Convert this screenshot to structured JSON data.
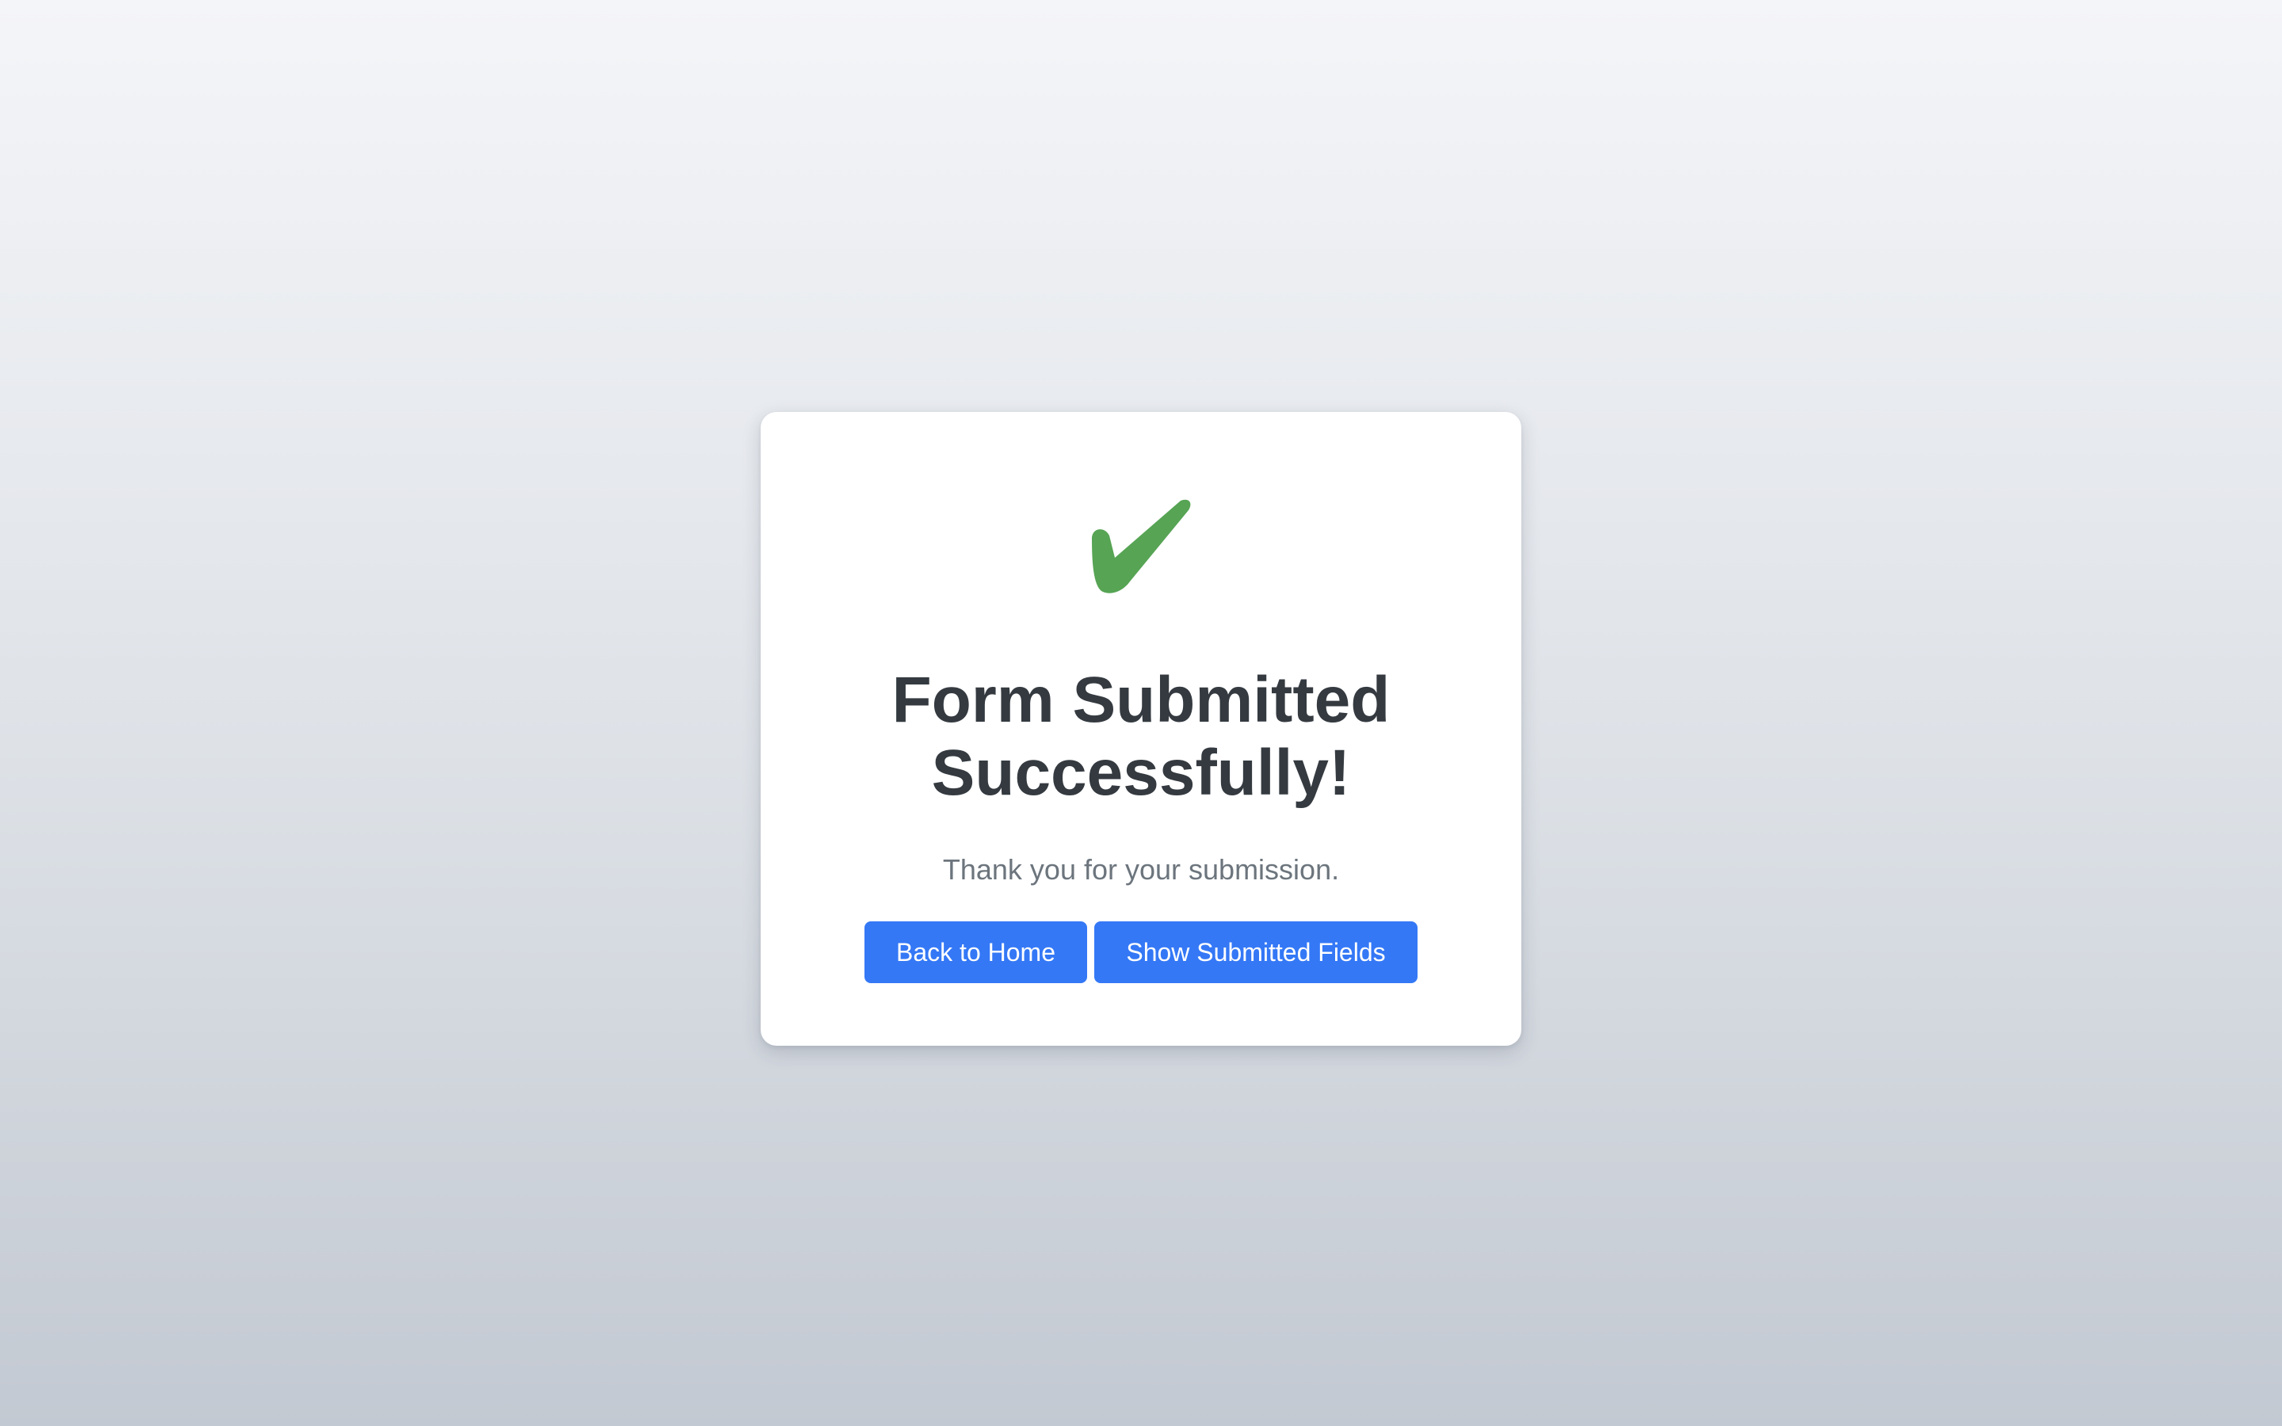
{
  "success": {
    "title": "Form Submitted Successfully!",
    "message": "Thank you for your submission.",
    "icon": "check-mark-icon",
    "icon_color": "#56a454"
  },
  "actions": {
    "back_home_label": "Back to Home",
    "show_fields_label": "Show Submitted Fields",
    "button_color": "#3478f6"
  }
}
